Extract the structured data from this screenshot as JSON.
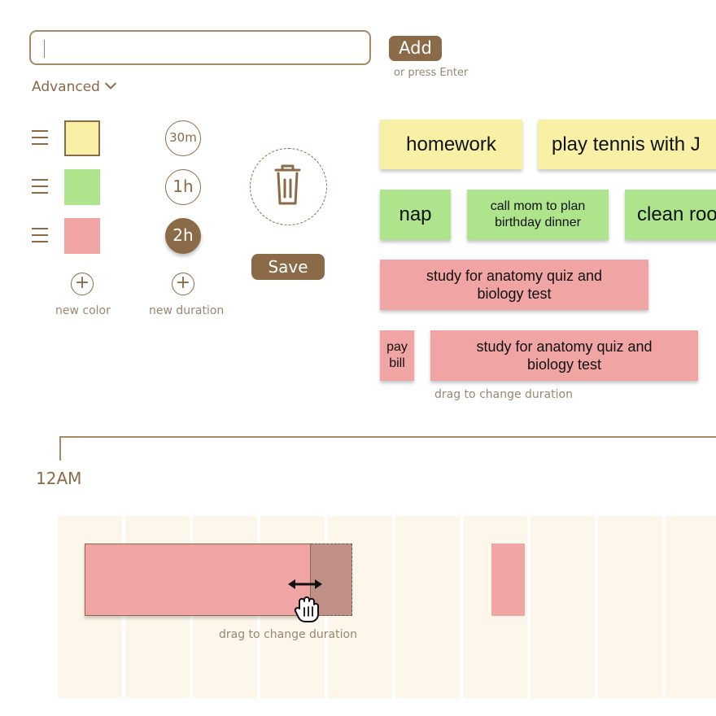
{
  "input": {
    "value": "",
    "placeholder": ""
  },
  "add_button": "Add",
  "add_hint": "or press Enter",
  "advanced_label": "Advanced",
  "colors": [
    {
      "hex": "#f8f0a4",
      "selected": true
    },
    {
      "hex": "#ade48c",
      "selected": false
    },
    {
      "hex": "#f0a4a4",
      "selected": false
    }
  ],
  "new_color_label": "new color",
  "durations": [
    {
      "label": "30m",
      "active": false
    },
    {
      "label": "1h",
      "active": false
    },
    {
      "label": "2h",
      "active": true
    }
  ],
  "new_duration_label": "new duration",
  "save_button": "Save",
  "tasks": {
    "homework": "homework",
    "play_tennis": "play tennis with J",
    "nap": "nap",
    "call_mom": "call mom to plan birthday dinner",
    "clean_room": "clean roo",
    "study_1": "study for anatomy quiz and biology test",
    "pay_bill": "pay bill",
    "study_2": "study for anatomy quiz and biology test"
  },
  "drag_hint_cards": "drag to change duration",
  "timeline": {
    "start_label": "12AM",
    "drag_hint": "drag to change duration"
  },
  "accent_color": "#8b6a47",
  "icons": [
    "drag-handle-icon",
    "chevron-down-icon",
    "plus-icon",
    "trash-icon",
    "resize-arrow-icon",
    "hand-cursor-icon"
  ]
}
